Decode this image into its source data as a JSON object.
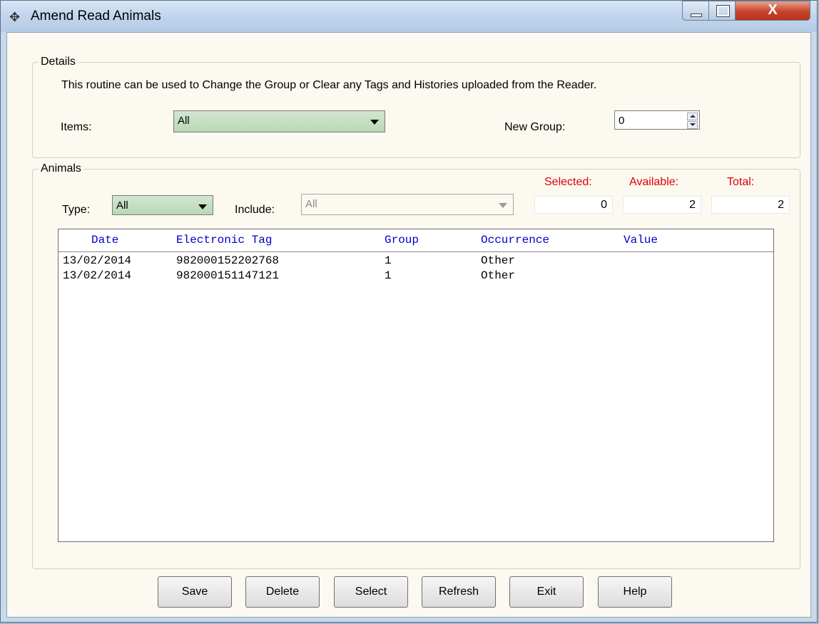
{
  "window": {
    "title": "Amend Read Animals",
    "close_glyph": "X"
  },
  "details": {
    "group_title": "Details",
    "description": "This routine can be used to Change the Group or Clear any Tags and Histories uploaded from the Reader.",
    "items_label": "Items:",
    "items_value": "All",
    "new_group_label": "New Group:",
    "new_group_value": "0"
  },
  "animals": {
    "group_title": "Animals",
    "type_label": "Type:",
    "type_value": "All",
    "include_label": "Include:",
    "include_value": "All",
    "selected_label": "Selected:",
    "available_label": "Available:",
    "total_label": "Total:",
    "selected_value": "0",
    "available_value": "2",
    "total_value": "2",
    "columns": [
      "Date",
      "Electronic Tag",
      "Group",
      "Occurrence",
      "Value"
    ],
    "rows": [
      {
        "date": "13/02/2014",
        "tag": "982000152202768",
        "group": "1",
        "occurrence": "Other",
        "value": ""
      },
      {
        "date": "13/02/2014",
        "tag": "982000151147121",
        "group": "1",
        "occurrence": "Other",
        "value": ""
      }
    ]
  },
  "buttons": {
    "save": "Save",
    "delete": "Delete",
    "select": "Select",
    "refresh": "Refresh",
    "exit": "Exit",
    "help": "Help"
  },
  "colors": {
    "accent_red": "#e00000",
    "header_blue": "#0000cc",
    "combo_green": "#b9d8b4"
  }
}
